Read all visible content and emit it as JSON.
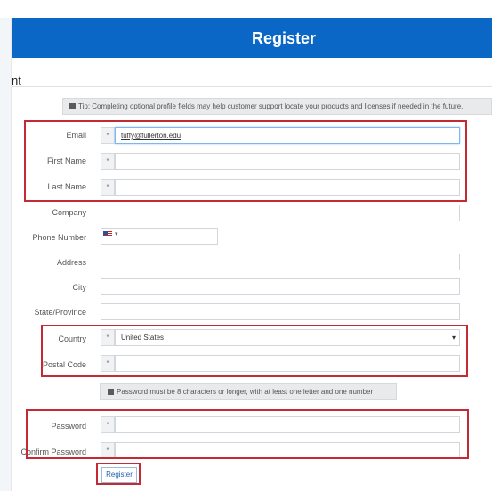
{
  "header": {
    "title": "Register"
  },
  "section": {
    "fragment": "nt"
  },
  "tip": {
    "text": "Tip: Completing optional profile fields may help customer support locate your products and licenses if needed in the future."
  },
  "fields": {
    "email": {
      "label": "Email",
      "required": "*",
      "value": "tuffy@fullerton.edu"
    },
    "first_name": {
      "label": "First Name",
      "required": "*",
      "value": ""
    },
    "last_name": {
      "label": "Last Name",
      "required": "*",
      "value": ""
    },
    "company": {
      "label": "Company",
      "value": ""
    },
    "phone": {
      "label": "Phone Number",
      "dropdown_arrow": "▾",
      "value": ""
    },
    "address": {
      "label": "Address",
      "value": ""
    },
    "city": {
      "label": "City",
      "value": ""
    },
    "state": {
      "label": "State/Province",
      "value": ""
    },
    "country": {
      "label": "Country",
      "required": "*",
      "value": "United States",
      "arrow": "▾"
    },
    "postal": {
      "label": "Postal Code",
      "required": "*",
      "value": ""
    },
    "password": {
      "label": "Password",
      "required": "*",
      "value": ""
    },
    "confirm_password": {
      "label": "Confirm Password",
      "required": "*",
      "value": ""
    }
  },
  "password_note": {
    "text": "Password must be 8 characters or longer, with at least one letter and one number"
  },
  "register_button": {
    "label": "Register"
  },
  "colors": {
    "header": "#0b67c6",
    "highlight": "#c42a34"
  },
  "icons": {
    "tip": "info-square-icon",
    "flag": "us-flag-icon"
  }
}
